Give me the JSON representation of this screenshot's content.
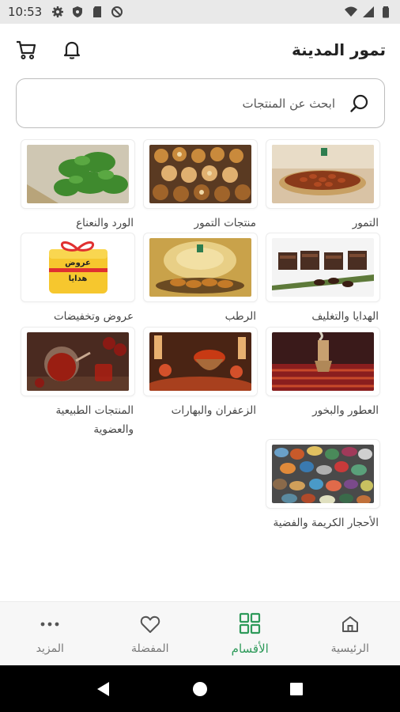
{
  "status_bar": {
    "time": "10:53"
  },
  "header": {
    "title": "تمور المدينة"
  },
  "search": {
    "placeholder": "ابحث عن المنتجات"
  },
  "categories": [
    {
      "label": "التمور",
      "image": "dates-platter"
    },
    {
      "label": "منتجات التمور",
      "image": "date-products"
    },
    {
      "label": "الورد والنعناع",
      "image": "mint-leaves"
    },
    {
      "label": "الهدايا والتغليف",
      "image": "gift-boxes"
    },
    {
      "label": "الرطب",
      "image": "fresh-dates"
    },
    {
      "label": "عروض وتخفيضات",
      "image": "offers-gift"
    },
    {
      "label": "العطور والبخور",
      "image": "incense-burner"
    },
    {
      "label": "الزعفران والبهارات",
      "image": "saffron-spices"
    },
    {
      "label": "المنتجات الطبيعية والعضوية",
      "image": "herbal-tea"
    },
    {
      "label": "الأحجار الكريمة والفضية",
      "image": "gemstones"
    }
  ],
  "offers_image_text": {
    "line1": "عروض",
    "line2": "هدايا"
  },
  "bottom_nav": [
    {
      "label": "الرئيسية",
      "icon": "home-icon"
    },
    {
      "label": "الأقسام",
      "icon": "grid-icon",
      "active": true
    },
    {
      "label": "المفضلة",
      "icon": "heart-icon"
    },
    {
      "label": "المزيد",
      "icon": "more-icon"
    }
  ],
  "colors": {
    "accent": "#2e9a5a",
    "nav_bg": "#f7f7f7",
    "status_bg": "#e9e9e9"
  }
}
